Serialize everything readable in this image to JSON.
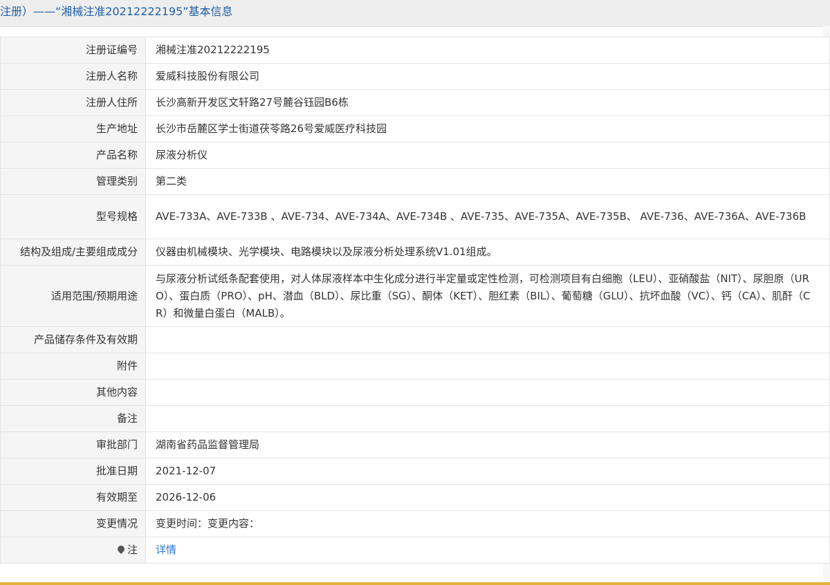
{
  "header": {
    "title": "注册）——“湘械注准20212222195”基本信息"
  },
  "rows": [
    {
      "label": "注册证编号",
      "value": "湘械注准20212222195"
    },
    {
      "label": "注册人名称",
      "value": "爱威科技股份有限公司"
    },
    {
      "label": "注册人住所",
      "value": "长沙高新开发区文轩路27号麓谷钰园B6栋"
    },
    {
      "label": "生产地址",
      "value": "长沙市岳麓区学士街道茯苓路26号爱威医疗科技园"
    },
    {
      "label": "产品名称",
      "value": "尿液分析仪"
    },
    {
      "label": "管理类别",
      "value": "第二类"
    },
    {
      "label": "型号规格",
      "value": "AVE-733A、AVE-733B 、AVE-734、AVE-734A、AVE-734B 、AVE-735、AVE-735A、AVE-735B、 AVE-736、AVE-736A、AVE-736B"
    },
    {
      "label": "结构及组成/主要组成成分",
      "value": "仪器由机械模块、光学模块、电路模块以及尿液分析处理系统V1.01组成。"
    },
    {
      "label": "适用范围/预期用途",
      "value": "与尿液分析试纸条配套使用，对人体尿液样本中生化成分进行半定量或定性检测，可检测项目有白细胞（LEU）、亚硝酸盐（NIT）、尿胆原（URO）、蛋白质（PRO）、pH、潜血（BLD）、尿比重（SG）、酮体（KET）、胆红素（BIL）、葡萄糖（GLU）、抗坏血酸（VC）、钙（CA）、肌酐（CR）和微量白蛋白（MALB）。"
    },
    {
      "label": "产品储存条件及有效期",
      "value": ""
    },
    {
      "label": "附件",
      "value": ""
    },
    {
      "label": "其他内容",
      "value": ""
    },
    {
      "label": "备注",
      "value": ""
    },
    {
      "label": "审批部门",
      "value": "湖南省药品监督管理局"
    },
    {
      "label": "批准日期",
      "value": "2021-12-07"
    },
    {
      "label": "有效期至",
      "value": "2026-12-06"
    },
    {
      "label": "变更情况",
      "value": "变更时间：变更内容："
    }
  ],
  "note": {
    "icon": "pin-icon",
    "label": "注",
    "link_text": "详情"
  },
  "colors": {
    "header_text": "#1f5fa8",
    "link": "#2a7ad4",
    "label_bg": "#f5f5f5",
    "bottom_bar": "#e2b33a"
  }
}
